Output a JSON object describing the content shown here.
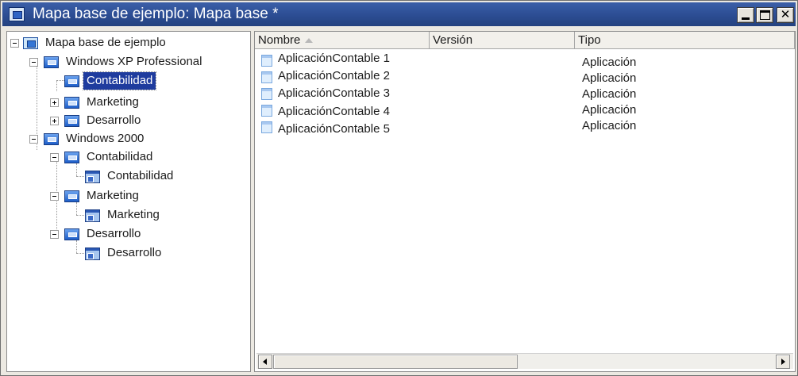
{
  "window": {
    "title": "Mapa base de ejemplo: Mapa base *",
    "controls": [
      "minimize",
      "maximize",
      "close"
    ],
    "title_bar_color": "#2c4d93",
    "selection_color": "#1f3c9e"
  },
  "tree": {
    "root": {
      "label": "Mapa base de ejemplo",
      "icon": "map-root-icon"
    },
    "items": [
      {
        "label": "Windows XP Professional",
        "icon": "group-icon",
        "expanded": true
      },
      {
        "label": "Contabilidad",
        "icon": "group-icon",
        "selected": true
      },
      {
        "label": "Marketing",
        "icon": "group-icon",
        "expanded": false
      },
      {
        "label": "Desarrollo",
        "icon": "group-icon",
        "expanded": false
      },
      {
        "label": "Windows 2000",
        "icon": "group-icon",
        "expanded": true
      },
      {
        "label": "Contabilidad",
        "icon": "group-icon",
        "expanded": true
      },
      {
        "label": "Contabilidad",
        "icon": "application-icon"
      },
      {
        "label": "Marketing",
        "icon": "group-icon",
        "expanded": true
      },
      {
        "label": "Marketing",
        "icon": "application-icon"
      },
      {
        "label": "Desarrollo",
        "icon": "group-icon",
        "expanded": true
      },
      {
        "label": "Desarrollo",
        "icon": "application-icon"
      }
    ]
  },
  "list": {
    "columns": [
      "Nombre",
      "Versión",
      "Tipo"
    ],
    "sort_column": "Nombre",
    "rows": [
      {
        "name": "AplicaciónContable 1",
        "version": "",
        "type": "Aplicación"
      },
      {
        "name": "AplicaciónContable 2",
        "version": "",
        "type": "Aplicación"
      },
      {
        "name": "AplicaciónContable 3",
        "version": "",
        "type": "Aplicación"
      },
      {
        "name": "AplicaciónContable 4",
        "version": "",
        "type": "Aplicación"
      },
      {
        "name": "AplicaciónContable 5",
        "version": "",
        "type": "Aplicación"
      }
    ]
  }
}
